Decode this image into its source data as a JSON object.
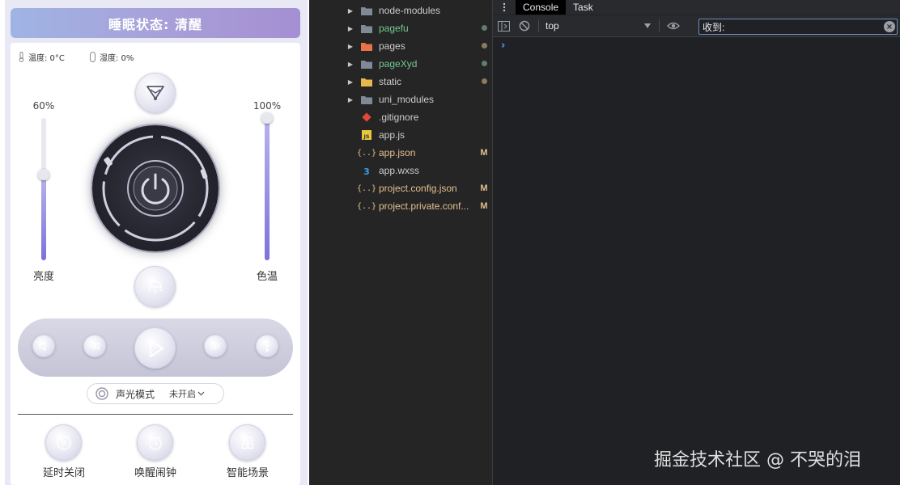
{
  "phone": {
    "status_title": "睡眠状态: 清醒",
    "temperature": "温度: 0°C",
    "humidity": "湿度: 0%",
    "brightness": {
      "label": "亮度",
      "percent_text": "60%",
      "value": 0.6
    },
    "color_temp": {
      "label": "色温",
      "percent_text": "100%",
      "value": 1.0
    },
    "sound_light_mode": {
      "label": "声光模式",
      "status": "未开启"
    },
    "bottom_actions": [
      {
        "label": "延时关闭",
        "icon": "timer-b-icon"
      },
      {
        "label": "唤醒闹钟",
        "icon": "alarm-clock-icon"
      },
      {
        "label": "智能场景",
        "icon": "scene-grid-icon"
      }
    ]
  },
  "explorer": {
    "items": [
      {
        "name": "node-modules",
        "type": "folder",
        "color": "#cccccc",
        "icon_color": "#7f8a96"
      },
      {
        "name": "pagefu",
        "type": "folder",
        "color": "#73c991",
        "icon_color": "#7f8a96",
        "dot": "#5f7f6a"
      },
      {
        "name": "pages",
        "type": "folder",
        "color": "#cccccc",
        "icon_color": "#e8734a",
        "dot": "#8a7a5e"
      },
      {
        "name": "pageXyd",
        "type": "folder",
        "color": "#73c991",
        "icon_color": "#7f8a96",
        "dot": "#5f7f6a"
      },
      {
        "name": "static",
        "type": "folder",
        "color": "#cccccc",
        "icon_color": "#e8b84a",
        "dot": "#8a7a5e"
      },
      {
        "name": "uni_modules",
        "type": "folder",
        "color": "#cccccc",
        "icon_color": "#7f8a96"
      },
      {
        "name": ".gitignore",
        "type": "git",
        "color": "#cccccc"
      },
      {
        "name": "app.js",
        "type": "js",
        "color": "#cccccc"
      },
      {
        "name": "app.json",
        "type": "json",
        "color": "#e2c08d",
        "badge": "M"
      },
      {
        "name": "app.wxss",
        "type": "css",
        "color": "#cccccc"
      },
      {
        "name": "project.config.json",
        "type": "json",
        "color": "#e2c08d",
        "badge": "M"
      },
      {
        "name": "project.private.conf...",
        "type": "json",
        "color": "#e2c08d",
        "badge": "M"
      }
    ]
  },
  "devtools": {
    "tabs": [
      "Console",
      "Task"
    ],
    "context": "top",
    "filter_value": "收到:",
    "prompt": "›"
  },
  "watermark": "掘金技术社区 @ 不哭的泪"
}
